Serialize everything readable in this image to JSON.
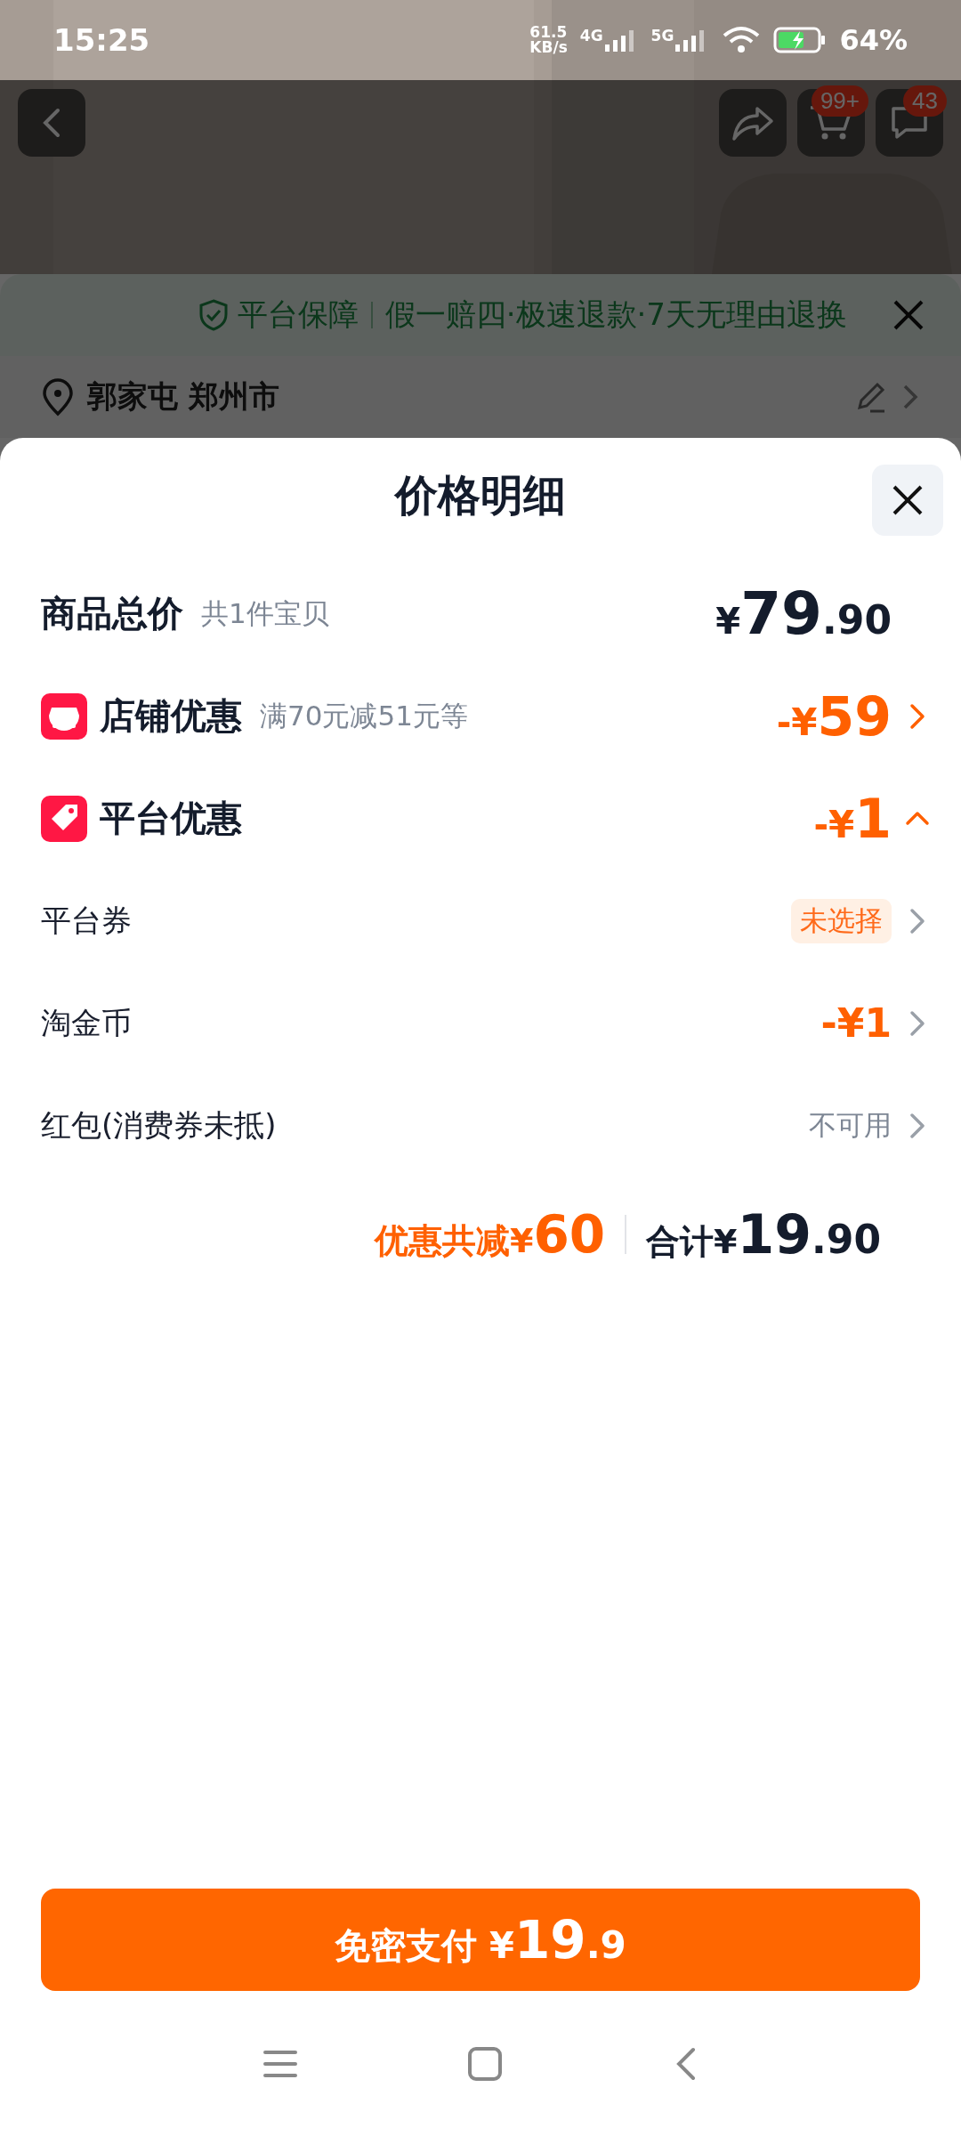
{
  "status_bar": {
    "time": "15:25",
    "speed_value": "61.5",
    "speed_unit": "KB/s",
    "network_1": "4G",
    "network_2": "5G",
    "battery": "64%"
  },
  "product_header": {
    "cart_badge": "99+",
    "message_badge": "43"
  },
  "guarantee": {
    "title": "平台保障",
    "details": "假一赔四·极速退款·7天无理由退换"
  },
  "address": {
    "text": "郭家屯 郑州市"
  },
  "price_sheet": {
    "title": "价格明细",
    "rows": [
      {
        "kind": "total",
        "label": "商品总价",
        "note": "共1件宝贝",
        "currency": "¥",
        "integer": "79",
        "decimal": ".90"
      },
      {
        "kind": "shop_discount",
        "label": "店铺优惠",
        "note": "满70元减51元等",
        "sign": "-",
        "currency": "¥",
        "integer": "59",
        "expanded": false
      },
      {
        "kind": "platform_discount",
        "label": "平台优惠",
        "sign": "-",
        "currency": "¥",
        "integer": "1",
        "expanded": true
      },
      {
        "kind": "tag",
        "label": "平台券",
        "value": "未选择"
      },
      {
        "kind": "amount",
        "label": "淘金币",
        "value": "-¥1"
      },
      {
        "kind": "muted",
        "label": "红包(消费券未抵)",
        "value": "不可用"
      }
    ],
    "summary": {
      "discount_label": "优惠共减",
      "discount_currency": "¥",
      "discount_integer": "60",
      "total_label": "合计",
      "total_currency": "¥",
      "total_integer": "19",
      "total_decimal": ".90"
    },
    "pay_button": {
      "label": "免密支付",
      "currency": "¥",
      "integer": "19",
      "decimal": ".9"
    }
  }
}
